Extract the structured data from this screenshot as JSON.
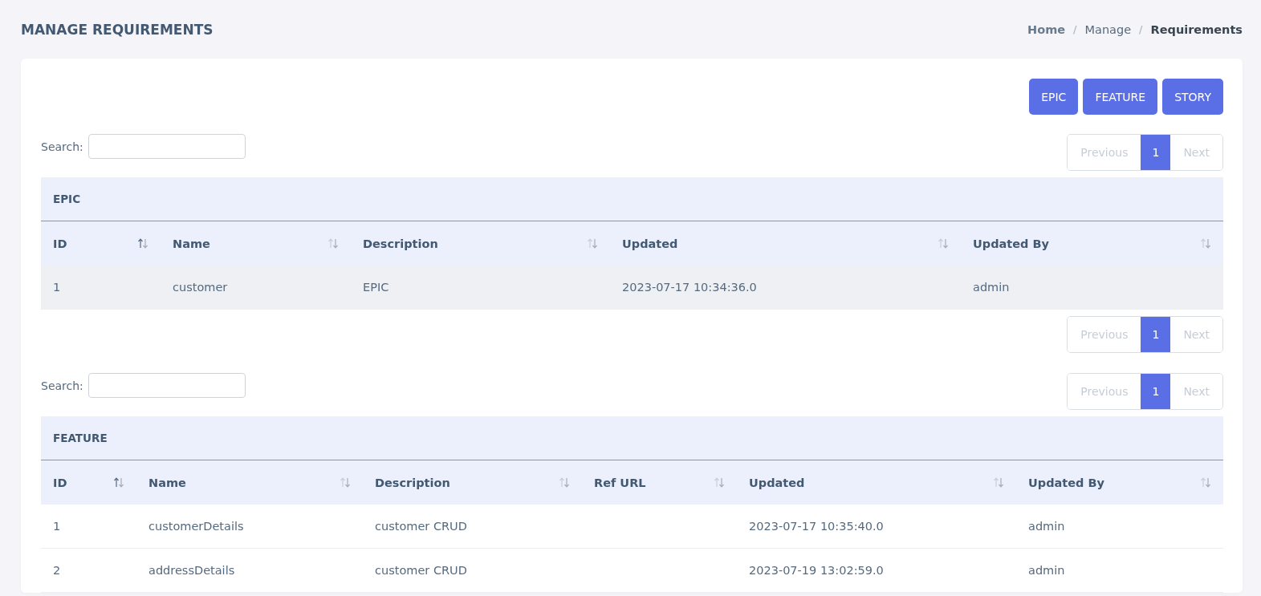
{
  "page_title": "MANAGE REQUIREMENTS",
  "breadcrumb": [
    {
      "label": "Home",
      "kind": "link"
    },
    {
      "label": "/",
      "kind": "separator"
    },
    {
      "label": "Manage",
      "kind": "text"
    },
    {
      "label": "/",
      "kind": "separator"
    },
    {
      "label": "Requirements",
      "kind": "current"
    }
  ],
  "action_buttons": [
    "EPIC",
    "FEATURE",
    "STORY"
  ],
  "tables": [
    {
      "search_label": "Search:",
      "caption": "EPIC",
      "pagination_top": {
        "previous": {
          "label": "Previous",
          "disabled": true
        },
        "pages": [
          {
            "label": "1",
            "selected": true
          }
        ],
        "next": {
          "label": "Next",
          "disabled": true
        }
      },
      "columns": [
        {
          "label": "ID",
          "sorted": true
        },
        {
          "label": "Name",
          "sorted": false
        },
        {
          "label": "Description",
          "sorted": false
        },
        {
          "label": "Updated",
          "sorted": false
        },
        {
          "label": "Updated By",
          "sorted": false
        }
      ],
      "rows": [
        {
          "highlighted": true,
          "cells": [
            "1",
            "customer",
            "EPIC",
            "2023-07-17 10:34:36.0",
            "admin"
          ]
        }
      ],
      "pagination_bottom": {
        "previous": {
          "label": "Previous",
          "disabled": true
        },
        "pages": [
          {
            "label": "1",
            "selected": true
          }
        ],
        "next": {
          "label": "Next",
          "disabled": true
        }
      }
    },
    {
      "search_label": "Search:",
      "caption": "FEATURE",
      "pagination_top": {
        "previous": {
          "label": "Previous",
          "disabled": true
        },
        "pages": [
          {
            "label": "1",
            "selected": true
          }
        ],
        "next": {
          "label": "Next",
          "disabled": true
        }
      },
      "columns": [
        {
          "label": "ID",
          "sorted": true
        },
        {
          "label": "Name",
          "sorted": false
        },
        {
          "label": "Description",
          "sorted": false
        },
        {
          "label": "Ref URL",
          "sorted": false
        },
        {
          "label": "Updated",
          "sorted": false
        },
        {
          "label": "Updated By",
          "sorted": false
        }
      ],
      "rows": [
        {
          "highlighted": false,
          "cells": [
            "1",
            "customerDetails",
            "customer CRUD",
            "",
            "2023-07-17 10:35:40.0",
            "admin"
          ]
        },
        {
          "highlighted": false,
          "cells": [
            "2",
            "addressDetails",
            "customer CRUD",
            "",
            "2023-07-19 13:02:59.0",
            "admin"
          ]
        }
      ]
    }
  ]
}
